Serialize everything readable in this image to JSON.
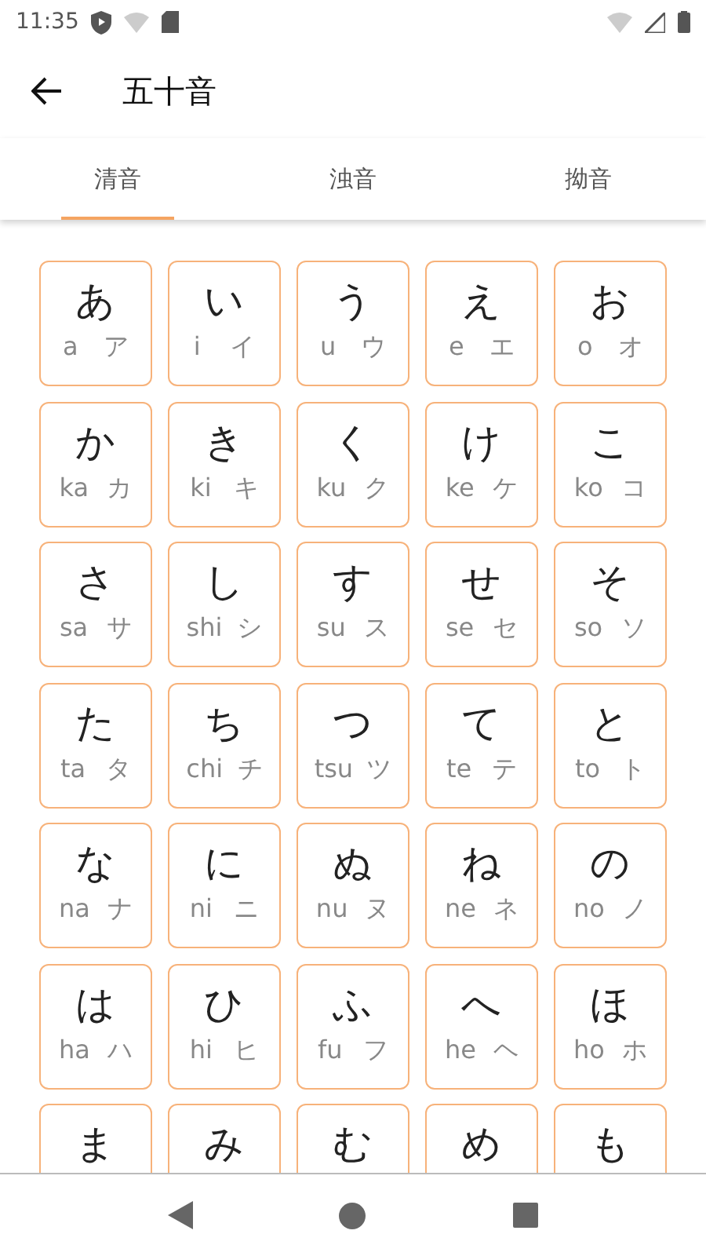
{
  "status_bar": {
    "time": "11:35"
  },
  "app_bar": {
    "title": "五十音"
  },
  "tabs": [
    {
      "label": "清音",
      "selected": true
    },
    {
      "label": "浊音",
      "selected": false
    },
    {
      "label": "拗音",
      "selected": false
    }
  ],
  "grid": [
    {
      "kana": "あ",
      "romaji": "a",
      "katakana": "ア"
    },
    {
      "kana": "い",
      "romaji": "i",
      "katakana": "イ"
    },
    {
      "kana": "う",
      "romaji": "u",
      "katakana": "ウ"
    },
    {
      "kana": "え",
      "romaji": "e",
      "katakana": "エ"
    },
    {
      "kana": "お",
      "romaji": "o",
      "katakana": "オ"
    },
    {
      "kana": "か",
      "romaji": "ka",
      "katakana": "カ"
    },
    {
      "kana": "き",
      "romaji": "ki",
      "katakana": "キ"
    },
    {
      "kana": "く",
      "romaji": "ku",
      "katakana": "ク"
    },
    {
      "kana": "け",
      "romaji": "ke",
      "katakana": "ケ"
    },
    {
      "kana": "こ",
      "romaji": "ko",
      "katakana": "コ"
    },
    {
      "kana": "さ",
      "romaji": "sa",
      "katakana": "サ"
    },
    {
      "kana": "し",
      "romaji": "shi",
      "katakana": "シ"
    },
    {
      "kana": "す",
      "romaji": "su",
      "katakana": "ス"
    },
    {
      "kana": "せ",
      "romaji": "se",
      "katakana": "セ"
    },
    {
      "kana": "そ",
      "romaji": "so",
      "katakana": "ソ"
    },
    {
      "kana": "た",
      "romaji": "ta",
      "katakana": "タ"
    },
    {
      "kana": "ち",
      "romaji": "chi",
      "katakana": "チ"
    },
    {
      "kana": "つ",
      "romaji": "tsu",
      "katakana": "ツ"
    },
    {
      "kana": "て",
      "romaji": "te",
      "katakana": "テ"
    },
    {
      "kana": "と",
      "romaji": "to",
      "katakana": "ト"
    },
    {
      "kana": "な",
      "romaji": "na",
      "katakana": "ナ"
    },
    {
      "kana": "に",
      "romaji": "ni",
      "katakana": "ニ"
    },
    {
      "kana": "ぬ",
      "romaji": "nu",
      "katakana": "ヌ"
    },
    {
      "kana": "ね",
      "romaji": "ne",
      "katakana": "ネ"
    },
    {
      "kana": "の",
      "romaji": "no",
      "katakana": "ノ"
    },
    {
      "kana": "は",
      "romaji": "ha",
      "katakana": "ハ"
    },
    {
      "kana": "ひ",
      "romaji": "hi",
      "katakana": "ヒ"
    },
    {
      "kana": "ふ",
      "romaji": "fu",
      "katakana": "フ"
    },
    {
      "kana": "へ",
      "romaji": "he",
      "katakana": "ヘ"
    },
    {
      "kana": "ほ",
      "romaji": "ho",
      "katakana": "ホ"
    },
    {
      "kana": "ま"
    },
    {
      "kana": "み"
    },
    {
      "kana": "む"
    },
    {
      "kana": "め"
    },
    {
      "kana": "も"
    }
  ]
}
